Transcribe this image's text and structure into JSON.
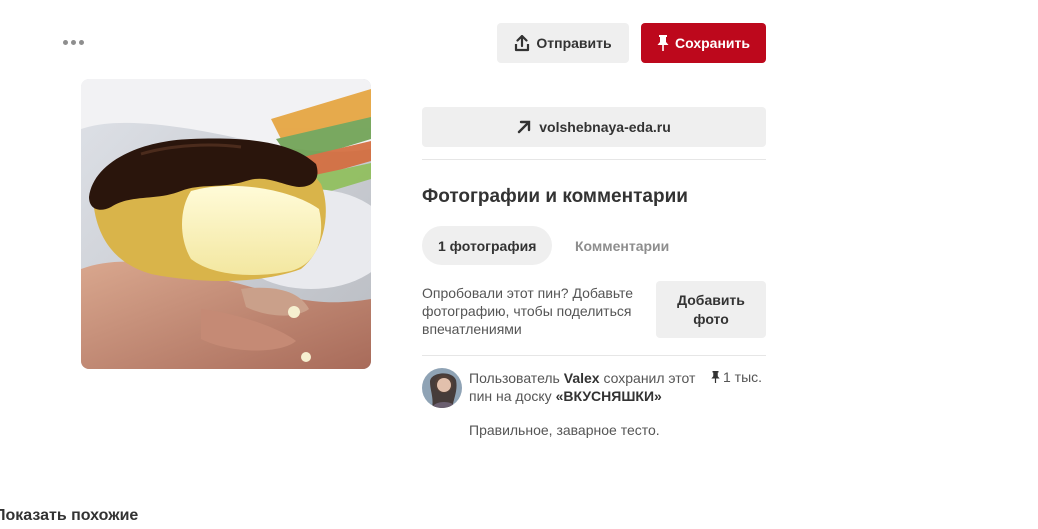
{
  "header": {
    "more_icon": "more-dots-icon",
    "send_label": "Отправить",
    "save_label": "Сохранить",
    "save_color": "#bd081c"
  },
  "pin": {
    "image_alt": "Эклер с шоколадной глазурью",
    "expand_icon": "expand-icon"
  },
  "link": {
    "domain": "volshebnaya-eda.ru",
    "icon": "arrow-up-right-icon"
  },
  "photos_section": {
    "title": "Фотографии и комментарии",
    "tabs": [
      {
        "label": "1 фотография",
        "active": true
      },
      {
        "label": "Комментарии",
        "active": false
      }
    ],
    "prompt": "Опробовали этот пин? Добавьте фотографию, чтобы поделиться впечатлениями",
    "add_photo_line1": "Добавить",
    "add_photo_line2": "фото"
  },
  "activity": {
    "prefix": "Пользователь ",
    "user": "Valex",
    "middle": " сохранил этот пин на доску ",
    "board": "«ВКУСНЯШКИ»",
    "description": "Правильное, заварное тесто.",
    "save_count": "1 тыс.",
    "pin_icon": "pin-icon"
  },
  "footer": {
    "show_similar": "Показать похожие"
  }
}
